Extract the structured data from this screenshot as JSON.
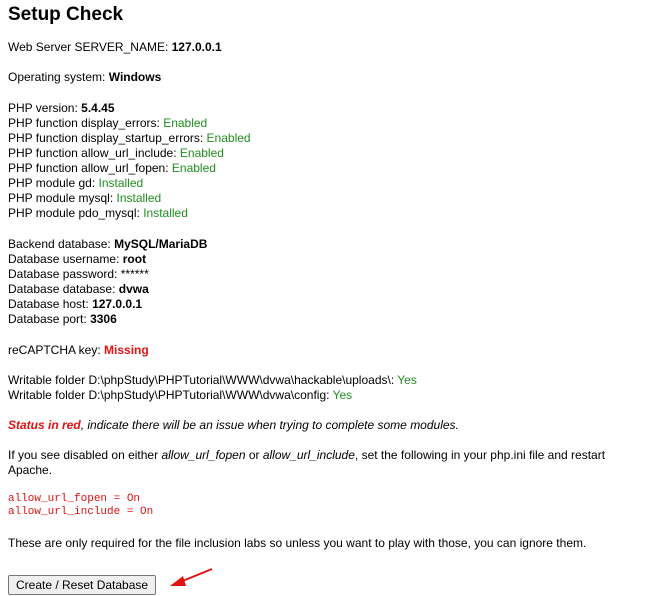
{
  "title": "Setup Check",
  "server": {
    "label": "Web Server SERVER_NAME: ",
    "value": "127.0.0.1"
  },
  "os": {
    "label": "Operating system: ",
    "value": "Windows"
  },
  "php": [
    {
      "label": "PHP version: ",
      "value": "5.4.45",
      "style": "b"
    },
    {
      "label": "PHP function display_errors: ",
      "value": "Enabled",
      "style": "green"
    },
    {
      "label": "PHP function display_startup_errors: ",
      "value": "Enabled",
      "style": "green"
    },
    {
      "label": "PHP function allow_url_include: ",
      "value": "Enabled",
      "style": "green"
    },
    {
      "label": "PHP function allow_url_fopen: ",
      "value": "Enabled",
      "style": "green"
    },
    {
      "label": "PHP module gd: ",
      "value": "Installed",
      "style": "green"
    },
    {
      "label": "PHP module mysql: ",
      "value": "Installed",
      "style": "green"
    },
    {
      "label": "PHP module pdo_mysql: ",
      "value": "Installed",
      "style": "green"
    }
  ],
  "db": [
    {
      "label": "Backend database: ",
      "value": "MySQL/MariaDB",
      "style": "b"
    },
    {
      "label": "Database username: ",
      "value": "root",
      "style": "b"
    },
    {
      "label": "Database password: ",
      "value": "******",
      "style": ""
    },
    {
      "label": "Database database: ",
      "value": "dvwa",
      "style": "b"
    },
    {
      "label": "Database host: ",
      "value": "127.0.0.1",
      "style": "b"
    },
    {
      "label": "Database port: ",
      "value": "3306",
      "style": "b"
    }
  ],
  "recaptcha": {
    "label": "reCAPTCHA key: ",
    "value": "Missing"
  },
  "writable": [
    {
      "label": "Writable folder D:\\phpStudy\\PHPTutorial\\WWW\\dvwa\\hackable\\uploads\\: ",
      "value": "Yes"
    },
    {
      "label": "Writable folder D:\\phpStudy\\PHPTutorial\\WWW\\dvwa\\config: ",
      "value": "Yes"
    }
  ],
  "status_note": {
    "red": "Status in red",
    "rest": ", indicate there will be an issue when trying to complete some modules."
  },
  "disabled_note": {
    "p1": "If you see disabled on either ",
    "i1": "allow_url_fopen",
    "p2": " or ",
    "i2": "allow_url_include",
    "p3": ", set the following in your php.ini file and restart",
    "line2": "Apache."
  },
  "config_lines": [
    "allow_url_fopen = On",
    "allow_url_include = On"
  ],
  "required_note": "These are only required for the file inclusion labs so unless you want to play with those, you can ignore them.",
  "button_label": "Create / Reset Database",
  "colors": {
    "ok": "#1f8e1f",
    "error": "#e21212",
    "arrow": "#e21212"
  }
}
